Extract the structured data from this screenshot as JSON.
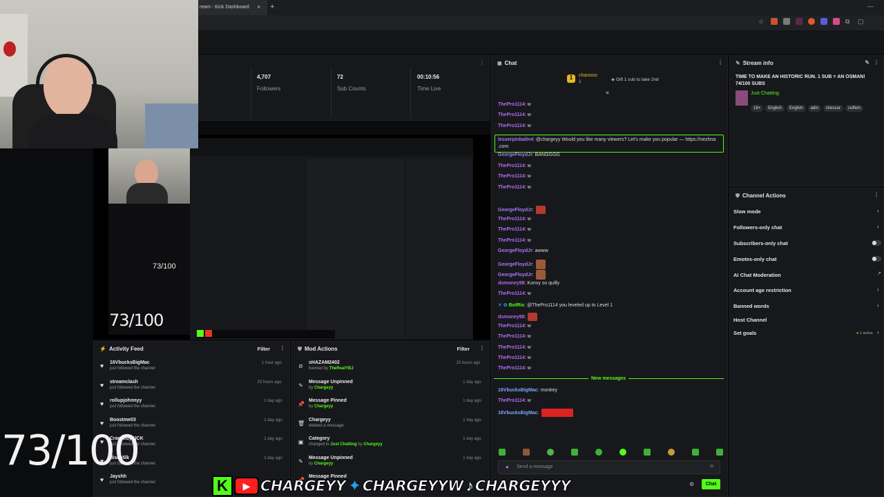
{
  "browser": {
    "tab_title": "ream - Kick Dashboard",
    "tab_close": "×",
    "new_tab": "+",
    "minimize": "—"
  },
  "stats": [
    {
      "value": "4,707",
      "label": "Followers"
    },
    {
      "value": "72",
      "label": "Sub Counts"
    },
    {
      "value": "00:10:56",
      "label": "Time Live"
    }
  ],
  "chat": {
    "title": "Chat",
    "pinned_user": "chanooo",
    "pinned_count": "2",
    "pinned_text": "Gift 1 sub to take 2nd",
    "messages": [
      {
        "user": "ThePro1114",
        "text": ": w"
      },
      {
        "user": "ThePro1114",
        "text": ": w"
      },
      {
        "user": "ThePro1114",
        "text": ": w"
      },
      {
        "user": "lesserpinballn4",
        "text": ": @chargeyy Would you like many viewers? Let's make you popular — https://nezhna",
        "text2": ".com"
      },
      {
        "user": "GeorgeFloydJr",
        "text": ": BANGGGG"
      },
      {
        "user": "ThePro1114",
        "text": ": w"
      },
      {
        "user": "ThePro1114",
        "text": ": w"
      },
      {
        "user": "ThePro1114",
        "text": ": w"
      },
      {
        "user": "GeorgeFloydJr",
        "text": ":"
      },
      {
        "user": "ThePro1114",
        "text": ": w"
      },
      {
        "user": "ThePro1114",
        "text": ": w"
      },
      {
        "user": "ThePro1114",
        "text": ": w"
      },
      {
        "user": "GeorgeFloydJr",
        "text": ": awww"
      },
      {
        "user": "GeorgeFloydJr",
        "text": ":"
      },
      {
        "user": "GeorgeFloydJr",
        "text": ":"
      },
      {
        "user": "dsmoney98",
        "text": ": Konvy so quilly"
      },
      {
        "user": "ThePro1114",
        "text": ": w"
      },
      {
        "user": "BotRix",
        "text": ": @ThePro1114 you leveled up to Level 1"
      },
      {
        "user": "dsmoney98",
        "text": ":"
      },
      {
        "user": "ThePro1114",
        "text": ": w"
      },
      {
        "user": "ThePro1114",
        "text": ": w"
      },
      {
        "user": "ThePro1114",
        "text": ": w"
      },
      {
        "user": "ThePro1114",
        "text": ": w"
      },
      {
        "user": "ThePro1114",
        "text": ": w"
      }
    ],
    "new_messages_label": "New messages",
    "new": [
      {
        "user": "16VbucksBigMac",
        "text": ": monkey"
      },
      {
        "user": "ThePro1114",
        "text": ": w"
      },
      {
        "user": "16VbucksBigMac",
        "text": ":"
      }
    ],
    "input_placeholder": "Send a message",
    "send_label": "Chat"
  },
  "stream_info": {
    "title": "Stream info",
    "stream_title": "TIME TO MAKE AN HISTORIC RUN. 1 SUB = AN OSMAN! 74/100 SUBS",
    "category": "Just Chatting",
    "tags": [
      "18+",
      "English",
      "English",
      "adin",
      "chessur",
      "cuffem"
    ]
  },
  "channel_actions": {
    "title": "Channel Actions",
    "items": [
      {
        "label": "Slow mode"
      },
      {
        "label": "Followers-only chat"
      },
      {
        "label": "Subscribers-only chat"
      },
      {
        "label": "Emotes-only chat"
      },
      {
        "label": "AI Chat Moderation"
      },
      {
        "label": "Account age restriction"
      },
      {
        "label": "Banned words"
      },
      {
        "label": "Host Channel"
      },
      {
        "label": "Set goals",
        "extra": "1 active"
      }
    ]
  },
  "activity_feed": {
    "title": "Activity Feed",
    "filter": "Filter",
    "items": [
      {
        "name": "16VbucksBigMac",
        "sub": "just followed the channel",
        "time": "1 hour ago"
      },
      {
        "name": "streamclash",
        "sub": "just followed the channel",
        "time": "23 hours ago"
      },
      {
        "name": "rollupjohnnyy",
        "sub": "just followed the channel",
        "time": "1 day ago"
      },
      {
        "name": "Boostme03",
        "sub": "just followed the channel",
        "time": "1 day ago"
      },
      {
        "name": "CrackedyKICK",
        "sub": "just followed the channel",
        "time": "1 day ago"
      },
      {
        "name": "disco5lk",
        "sub": "just followed the channel",
        "time": "1 day ago"
      },
      {
        "name": "Jayshh",
        "sub": "just followed the channel",
        "time": ""
      }
    ]
  },
  "mod_actions": {
    "title": "Mod Actions",
    "filter": "Filter",
    "items": [
      {
        "name": "sHAZAM2402",
        "pre": "banned by ",
        "by": "TheRealYBJ",
        "time": "15 hours ago"
      },
      {
        "name": "Message Unpinned",
        "pre": "by ",
        "by": "Chargeyy",
        "time": "1 day ago"
      },
      {
        "name": "Message Pinned",
        "pre": "by ",
        "by": "Chargeyy",
        "time": "1 day ago"
      },
      {
        "name": "Chargeyy",
        "pre": "deleted a message",
        "by": "",
        "time": "1 day ago"
      },
      {
        "name": "Category",
        "pre": "changed to ",
        "by": "Just Chatting",
        "mid": " by ",
        "by2": "Chargeyy",
        "time": "1 day ago"
      },
      {
        "name": "Message Unpinned",
        "pre": "by ",
        "by": "Chargeyy",
        "time": "1 day ago"
      },
      {
        "name": "Message Pinned",
        "pre": "",
        "by": "",
        "time": ""
      }
    ]
  },
  "overlay": {
    "big_count": "73/100",
    "medium_count": "73/100",
    "small_count": "73/100",
    "socials": [
      "CHARGEYY",
      "CHARGEYYW",
      "CHARGEYYY"
    ]
  },
  "colors": {
    "kick_green": "#53fc18",
    "username_purple": "#b26bf2"
  }
}
